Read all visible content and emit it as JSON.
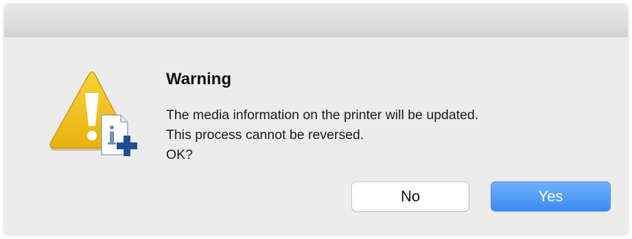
{
  "dialog": {
    "title": "Warning",
    "message_lines": [
      "The media information on the printer will be updated.",
      "This process cannot be reversed.",
      "OK?"
    ],
    "icon": "warning-info-plus-icon"
  },
  "buttons": {
    "no_label": "No",
    "yes_label": "Yes"
  },
  "colors": {
    "accent": "#4a8ff5",
    "warning": "#f2c21e",
    "plus": "#1f4f93"
  }
}
